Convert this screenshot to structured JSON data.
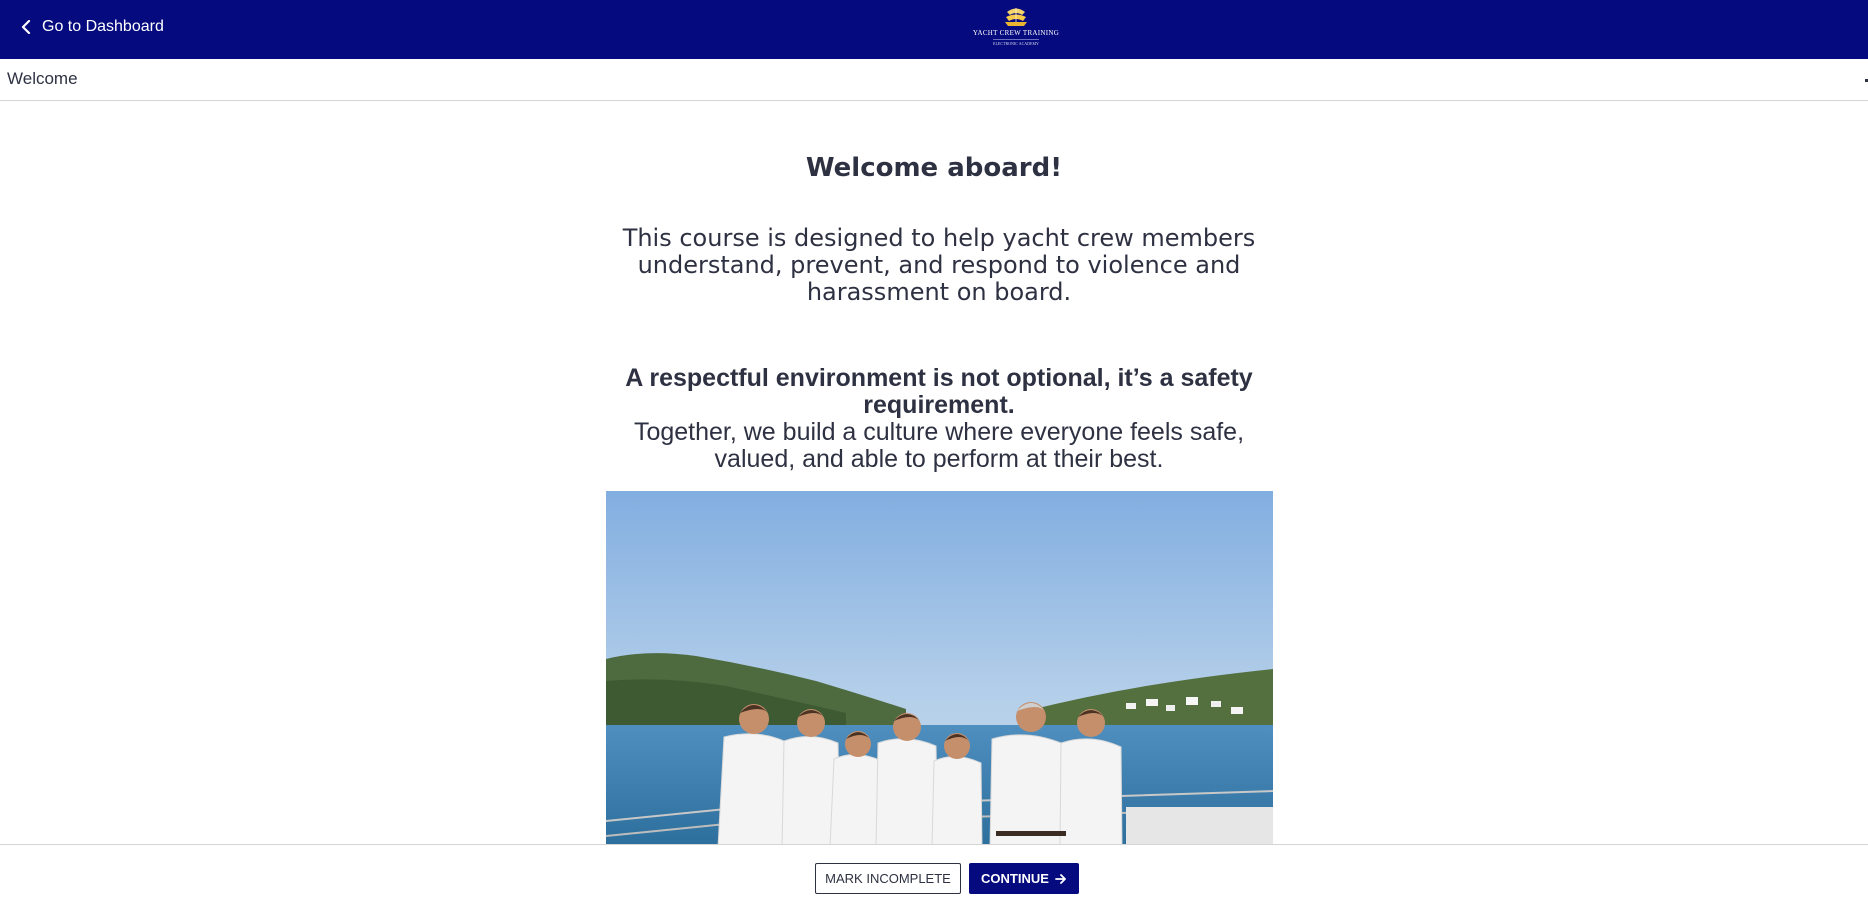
{
  "topbar": {
    "back_label": "Go to Dashboard",
    "logo_text": "YACHT CREW TRAINING",
    "logo_subtext": "ELECTRONIC ACADEMY",
    "background": "#050a7e"
  },
  "lesson": {
    "title": "Welcome"
  },
  "content": {
    "heading": "Welcome aboard!",
    "intro": "This course is designed to help yacht crew members understand, prevent, and respond to violence and harassment on board.",
    "respect_strong": "A respectful environment is not optional, it’s a safety requirement.",
    "respect_normal": "Together, we build a culture where everyone feels safe, valued, and able to perform at their best.",
    "image_subject": "crew-photo"
  },
  "footer": {
    "mark_incomplete_label": "MARK INCOMPLETE",
    "continue_label": "CONTINUE",
    "accent": "#050a7e"
  },
  "icons": {
    "back": "chevron-left-icon",
    "continue": "arrow-right-icon",
    "logo": "ship-logo-icon"
  }
}
